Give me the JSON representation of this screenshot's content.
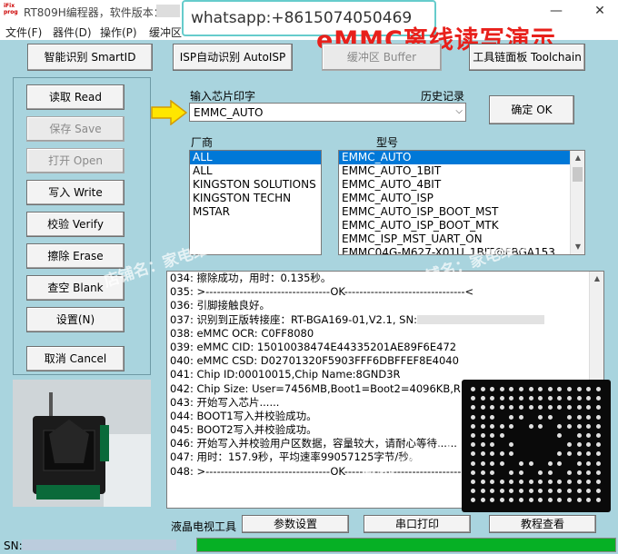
{
  "titlebar": {
    "app_icon_text": "iFix prog",
    "title": "RT809H编程器，软件版本：",
    "minimize": "—",
    "close": "✕"
  },
  "overlay": {
    "whatsapp": "whatsapp:+8615074050469"
  },
  "menu": [
    "文件(F)",
    "器件(D)",
    "操作(P)",
    "缓冲区"
  ],
  "demo_title": "eMMC离线读写演示",
  "top_buttons": {
    "smart_id": "智能识别 SmartID",
    "isp_auto": "ISP自动识别 AutoISP",
    "buffer": "缓冲区 Buffer",
    "toolchain": "工具链面板 Toolchain"
  },
  "left_buttons": [
    {
      "label": "读取 Read",
      "enabled": true
    },
    {
      "label": "保存 Save",
      "enabled": false
    },
    {
      "label": "打开 Open",
      "enabled": false
    },
    {
      "label": "写入 Write",
      "enabled": true
    },
    {
      "label": "校验 Verify",
      "enabled": true
    },
    {
      "label": "擦除 Erase",
      "enabled": true
    },
    {
      "label": "查空 Blank",
      "enabled": true
    },
    {
      "label": "设置(N)",
      "enabled": true
    }
  ],
  "cancel_button": "取消 Cancel",
  "chip_input": {
    "label": "输入芯片印字",
    "history_label": "历史记录",
    "value": "EMMC_AUTO",
    "confirm_button": "确定 OK"
  },
  "vendor": {
    "label": "厂商",
    "items": [
      "ALL",
      "ALL",
      "KINGSTON SOLUTIONS",
      "KINGSTON TECHN",
      "MSTAR"
    ],
    "selected_index": 0
  },
  "model": {
    "label": "型号",
    "items": [
      "EMMC_AUTO",
      "EMMC_AUTO_1BIT",
      "EMMC_AUTO_4BIT",
      "EMMC_AUTO_ISP",
      "EMMC_AUTO_ISP_BOOT_MST",
      "EMMC_AUTO_ISP_BOOT_MTK",
      "EMMC_ISP_MST_UART_ON",
      "EMMC04G-M627-X01U_1BIT@FBGA153"
    ],
    "selected_index": 0
  },
  "log": [
    "034:  擦除成功，用时：0.135秒。",
    "035:  >---------------------------------OK--------------------------------<",
    "036:  引脚接触良好。",
    "037:  识别到正版转接座：RT-BGA169-01,V2.1, SN:",
    "038:  eMMC OCR: C0FF8080",
    "039:  eMMC CID:  15010038474E44335201AE89F6E472",
    "040:  eMMC CSD: D02701320F5903FFF6DBFFEF8E4040",
    "041:  Chip ID:00010015,Chip Name:8GND3R",
    "042:  Chip Size: User=7456MB,Boot1=Boot2=4096KB,RPMB=",
    "043:  开始写入芯片......",
    "044:  BOOT1写入并校验成功。",
    "045:  BOOT2写入并校验成功。",
    "046:  开始写入并校验用户区数据，容量较大，请耐心等待......",
    "047:  用时：157.9秒，平均速率99057125字节/秒。",
    "048:  >---------------------------------OK--------------------------------<"
  ],
  "watermarks": [
    "店铺名：家电维修论坛",
    "店铺名：家电维修论坛",
    "店铺名：家电维修论坛"
  ],
  "bottom": {
    "tv_tools": "液晶电视工具",
    "params": "参数设置",
    "serial_print": "串口打印",
    "tutorial": "教程查看",
    "sn_label": "SN:",
    "progress": 1.0
  },
  "colors": {
    "window_bg": "#a9d4de",
    "selection": "#0078d7",
    "demo_title": "#e8201b",
    "progress": "#06b025",
    "arrow": "#ffe600"
  }
}
